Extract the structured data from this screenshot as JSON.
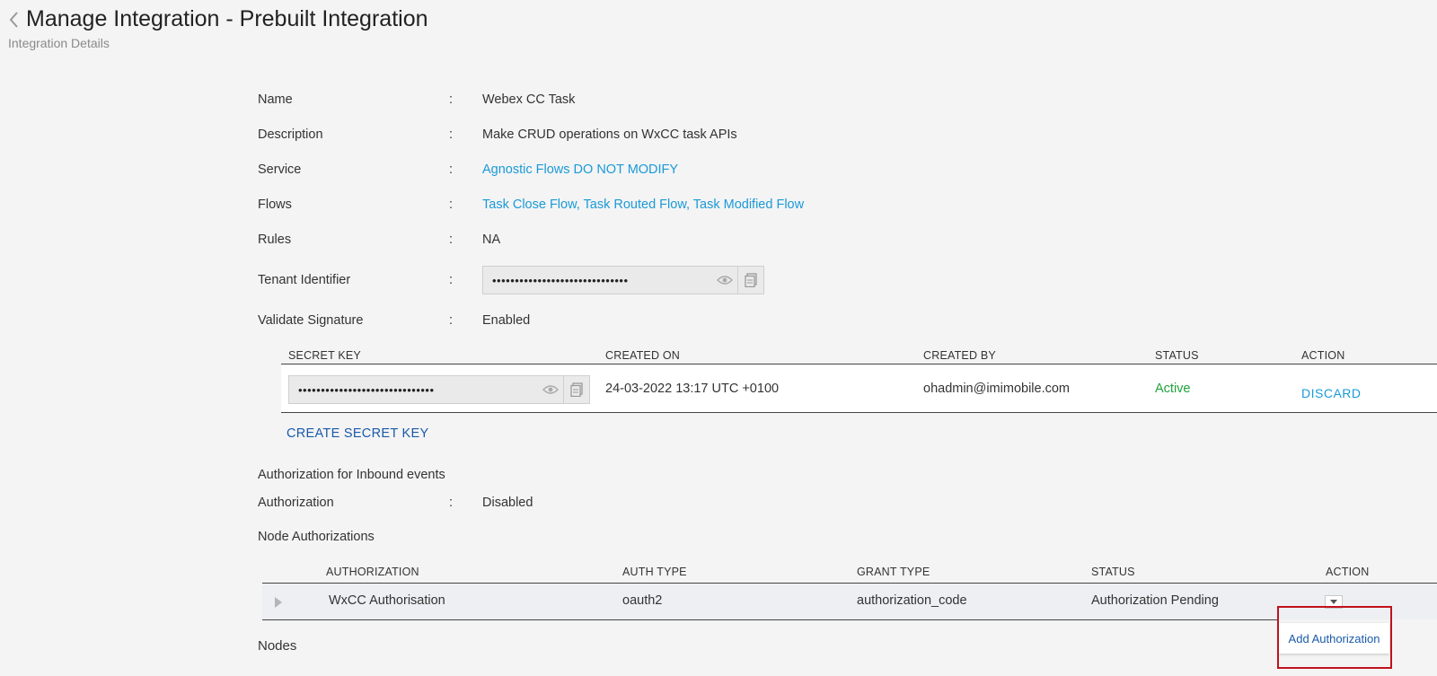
{
  "header": {
    "title": "Manage Integration - Prebuilt Integration",
    "subtitle": "Integration Details"
  },
  "details": {
    "name_label": "Name",
    "name_value": "Webex CC Task",
    "description_label": "Description",
    "description_value": "Make CRUD operations on WxCC task APIs",
    "service_label": "Service",
    "service_value": "Agnostic Flows DO NOT MODIFY",
    "flows_label": "Flows",
    "flows_value": "Task Close Flow, Task Routed Flow, Task Modified Flow",
    "rules_label": "Rules",
    "rules_value": "NA",
    "tenant_label": "Tenant Identifier",
    "tenant_value": "••••••••••••••••••••••••••••••",
    "validate_label": "Validate Signature",
    "validate_value": "Enabled",
    "colon": ":"
  },
  "secret_keys": {
    "columns": [
      "SECRET KEY",
      "CREATED ON",
      "CREATED BY",
      "STATUS",
      "ACTION"
    ],
    "row": {
      "key_value": "••••••••••••••••••••••••••••••",
      "created_on": "24-03-2022 13:17 UTC +0100",
      "created_by": "ohadmin@imimobile.com",
      "status": "Active",
      "action": "DISCARD"
    },
    "create_label": "CREATE SECRET KEY"
  },
  "inbound": {
    "heading": "Authorization for Inbound events",
    "auth_label": "Authorization",
    "auth_value": "Disabled"
  },
  "node_auth": {
    "heading": "Node Authorizations",
    "columns": [
      "AUTHORIZATION",
      "AUTH TYPE",
      "GRANT TYPE",
      "STATUS",
      "ACTION"
    ],
    "row": {
      "authorization": "WxCC Authorisation",
      "auth_type": "oauth2",
      "grant_type": "authorization_code",
      "status": "Authorization Pending"
    },
    "menu_item": "Add Authorization"
  },
  "nodes": {
    "heading": "Nodes"
  },
  "colors": {
    "link": "#1a9ad6",
    "active": "#1fa33c",
    "highlight": "#c0121c",
    "primary": "#1a5aa8"
  }
}
